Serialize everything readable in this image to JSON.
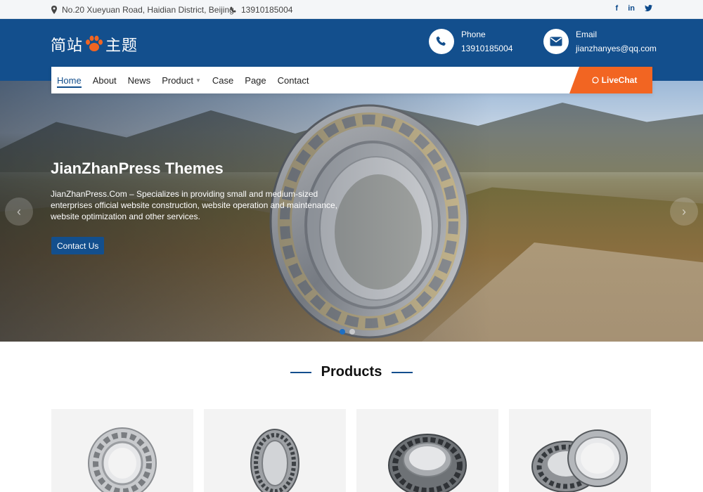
{
  "topbar": {
    "address": "No.20 Xueyuan Road, Haidian District, Beijing",
    "phone": "13910185004",
    "social": [
      "f",
      "in",
      "t"
    ]
  },
  "header": {
    "logo_left": "简站",
    "logo_right": "主题",
    "phone_label": "Phone",
    "phone_value": "13910185004",
    "email_label": "Email",
    "email_value": "jianzhanyes@qq.com"
  },
  "nav": {
    "items": [
      {
        "label": "Home",
        "active": true
      },
      {
        "label": "About"
      },
      {
        "label": "News"
      },
      {
        "label": "Product",
        "dropdown": true
      },
      {
        "label": "Case"
      },
      {
        "label": "Page"
      },
      {
        "label": "Contact"
      }
    ],
    "livechat": "LiveChat"
  },
  "hero": {
    "title": "JianZhanPress Themes",
    "description": "JianZhanPress.Com – Specializes in providing small and medium-sized enterprises official website construction, website operation and maintenance, website optimization and other services.",
    "cta": "Contact Us",
    "slides": 2,
    "current_slide": 1
  },
  "products": {
    "title": "Products"
  },
  "colors": {
    "primary": "#134f8d",
    "accent": "#f26522",
    "topbar_bg": "#f4f6f8"
  }
}
